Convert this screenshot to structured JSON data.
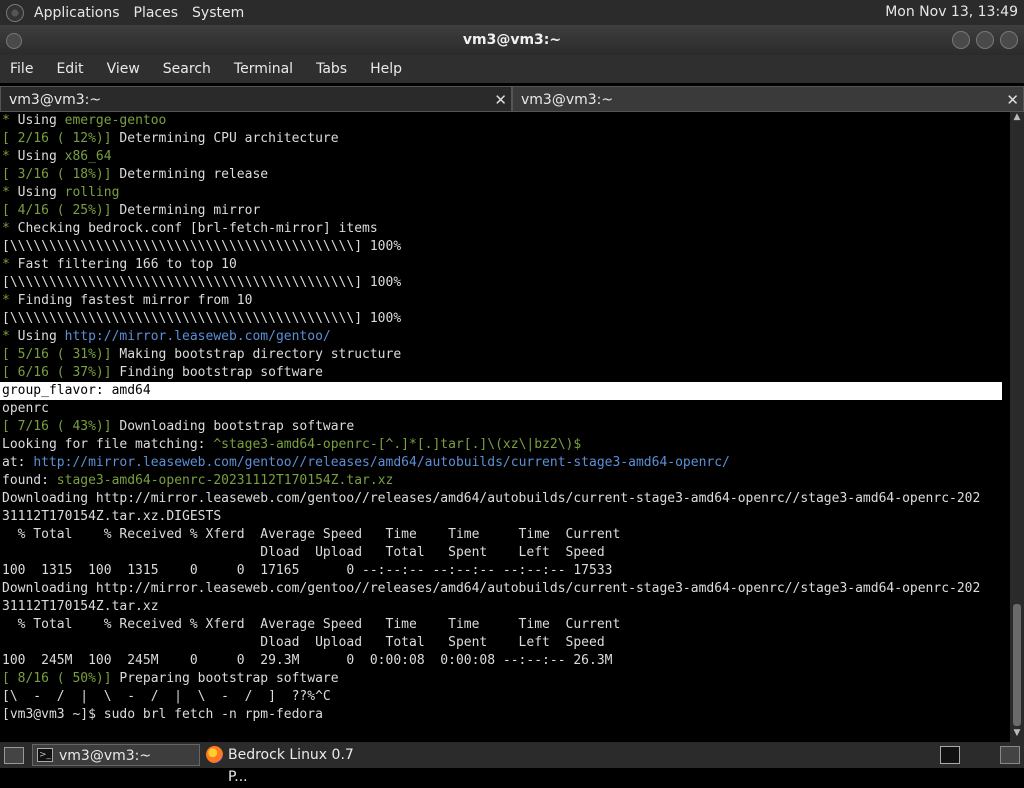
{
  "top_panel": {
    "menus": [
      "Applications",
      "Places",
      "System"
    ],
    "clock": "Mon Nov 13, 13:49"
  },
  "window": {
    "title": "vm3@vm3:~"
  },
  "menubar": [
    "File",
    "Edit",
    "View",
    "Search",
    "Terminal",
    "Tabs",
    "Help"
  ],
  "tabs": [
    {
      "label": "vm3@vm3:~",
      "active": true
    },
    {
      "label": "vm3@vm3:~",
      "active": false
    }
  ],
  "terminal": {
    "lines": [
      {
        "segments": [
          {
            "t": "* ",
            "c": "green"
          },
          {
            "t": "Using "
          },
          {
            "t": "emerge-gentoo",
            "c": "green"
          }
        ]
      },
      {
        "segments": [
          {
            "t": "[ 2/16 ( 12%)] ",
            "c": "green"
          },
          {
            "t": "Determining CPU architecture"
          }
        ]
      },
      {
        "segments": [
          {
            "t": "* ",
            "c": "green"
          },
          {
            "t": "Using "
          },
          {
            "t": "x86_64",
            "c": "green"
          }
        ]
      },
      {
        "segments": [
          {
            "t": "[ 3/16 ( 18%)] ",
            "c": "green"
          },
          {
            "t": "Determining release"
          }
        ]
      },
      {
        "segments": [
          {
            "t": "* ",
            "c": "green"
          },
          {
            "t": "Using "
          },
          {
            "t": "rolling",
            "c": "green"
          }
        ]
      },
      {
        "segments": [
          {
            "t": "[ 4/16 ( 25%)] ",
            "c": "green"
          },
          {
            "t": "Determining mirror"
          }
        ]
      },
      {
        "segments": [
          {
            "t": "* ",
            "c": "green"
          },
          {
            "t": "Checking bedrock.conf [brl-fetch-mirror] items"
          }
        ]
      },
      {
        "segments": [
          {
            "t": "[\\\\\\\\\\\\\\\\\\\\\\\\\\\\\\\\\\\\\\\\\\\\\\\\\\\\\\\\\\\\\\\\\\\\\\\\\\\\\\\\\\\\\\\\] 100%"
          }
        ]
      },
      {
        "segments": [
          {
            "t": "* ",
            "c": "green"
          },
          {
            "t": "Fast filtering 166 to top 10"
          }
        ]
      },
      {
        "segments": [
          {
            "t": "[\\\\\\\\\\\\\\\\\\\\\\\\\\\\\\\\\\\\\\\\\\\\\\\\\\\\\\\\\\\\\\\\\\\\\\\\\\\\\\\\\\\\\\\\] 100%"
          }
        ]
      },
      {
        "segments": [
          {
            "t": "* ",
            "c": "green"
          },
          {
            "t": "Finding fastest mirror from 10"
          }
        ]
      },
      {
        "segments": [
          {
            "t": "[\\\\\\\\\\\\\\\\\\\\\\\\\\\\\\\\\\\\\\\\\\\\\\\\\\\\\\\\\\\\\\\\\\\\\\\\\\\\\\\\\\\\\\\\] 100%"
          }
        ]
      },
      {
        "segments": [
          {
            "t": "* ",
            "c": "green"
          },
          {
            "t": "Using "
          },
          {
            "t": "http://mirror.leaseweb.com/gentoo/",
            "c": "blue"
          }
        ]
      },
      {
        "segments": [
          {
            "t": "[ 5/16 ( 31%)] ",
            "c": "green"
          },
          {
            "t": "Making bootstrap directory structure"
          }
        ]
      },
      {
        "segments": [
          {
            "t": "[ 6/16 ( 37%)] ",
            "c": "green"
          },
          {
            "t": "Finding bootstrap software"
          }
        ]
      },
      {
        "segments": [
          {
            "t": "group_flavor: amd64"
          }
        ],
        "highlight": true
      },
      {
        "segments": [
          {
            "t": "openrc"
          }
        ]
      },
      {
        "segments": [
          {
            "t": "[ 7/16 ( 43%)] ",
            "c": "green"
          },
          {
            "t": "Downloading bootstrap software"
          }
        ]
      },
      {
        "segments": [
          {
            "t": "Looking for file matching: "
          },
          {
            "t": "^stage3-amd64-openrc-[^.]*[.]tar[.]\\(xz\\|bz2\\)$",
            "c": "green"
          }
        ]
      },
      {
        "segments": [
          {
            "t": "at: "
          },
          {
            "t": "http://mirror.leaseweb.com/gentoo//releases/amd64/autobuilds/current-stage3-amd64-openrc/",
            "c": "blue"
          }
        ]
      },
      {
        "segments": [
          {
            "t": "found: "
          },
          {
            "t": "stage3-amd64-openrc-20231112T170154Z.tar.xz",
            "c": "green"
          }
        ]
      },
      {
        "segments": [
          {
            "t": "Downloading http://mirror.leaseweb.com/gentoo//releases/amd64/autobuilds/current-stage3-amd64-openrc//stage3-amd64-openrc-202"
          }
        ]
      },
      {
        "segments": [
          {
            "t": "31112T170154Z.tar.xz.DIGESTS"
          }
        ]
      },
      {
        "segments": [
          {
            "t": "  % Total    % Received % Xferd  Average Speed   Time    Time     Time  Current"
          }
        ]
      },
      {
        "segments": [
          {
            "t": "                                 Dload  Upload   Total   Spent    Left  Speed"
          }
        ]
      },
      {
        "segments": [
          {
            "t": "100  1315  100  1315    0     0  17165      0 --:--:-- --:--:-- --:--:-- 17533"
          }
        ]
      },
      {
        "segments": [
          {
            "t": "Downloading http://mirror.leaseweb.com/gentoo//releases/amd64/autobuilds/current-stage3-amd64-openrc//stage3-amd64-openrc-202"
          }
        ]
      },
      {
        "segments": [
          {
            "t": "31112T170154Z.tar.xz"
          }
        ]
      },
      {
        "segments": [
          {
            "t": "  % Total    % Received % Xferd  Average Speed   Time    Time     Time  Current"
          }
        ]
      },
      {
        "segments": [
          {
            "t": "                                 Dload  Upload   Total   Spent    Left  Speed"
          }
        ]
      },
      {
        "segments": [
          {
            "t": "100  245M  100  245M    0     0  29.3M      0  0:00:08  0:00:08 --:--:-- 26.3M"
          }
        ]
      },
      {
        "segments": [
          {
            "t": "[ 8/16 ( 50%)] ",
            "c": "green"
          },
          {
            "t": "Preparing bootstrap software"
          }
        ]
      },
      {
        "segments": [
          {
            "t": "[\\  -  /  |  \\  -  /  |  \\  -  /  ]  ??%^C"
          }
        ]
      },
      {
        "segments": [
          {
            "t": "[vm3@vm3 ~]$ sudo brl fetch -n rpm-fedora"
          }
        ]
      }
    ]
  },
  "taskbar": {
    "items": [
      {
        "label": "vm3@vm3:~",
        "active": true
      },
      {
        "label": "Bedrock Linux 0.7 P...",
        "active": false
      }
    ]
  },
  "colors": {
    "green": "#7a9f3f",
    "blue": "#5b8fd6",
    "text": "#dcdcdc",
    "background": "#000000"
  },
  "icons": {
    "top_panel_logo": "gnome-foot-icon",
    "term_icon": "terminal-icon",
    "browser_icon": "firefox-icon",
    "show_desktop": "desktop-icon"
  }
}
